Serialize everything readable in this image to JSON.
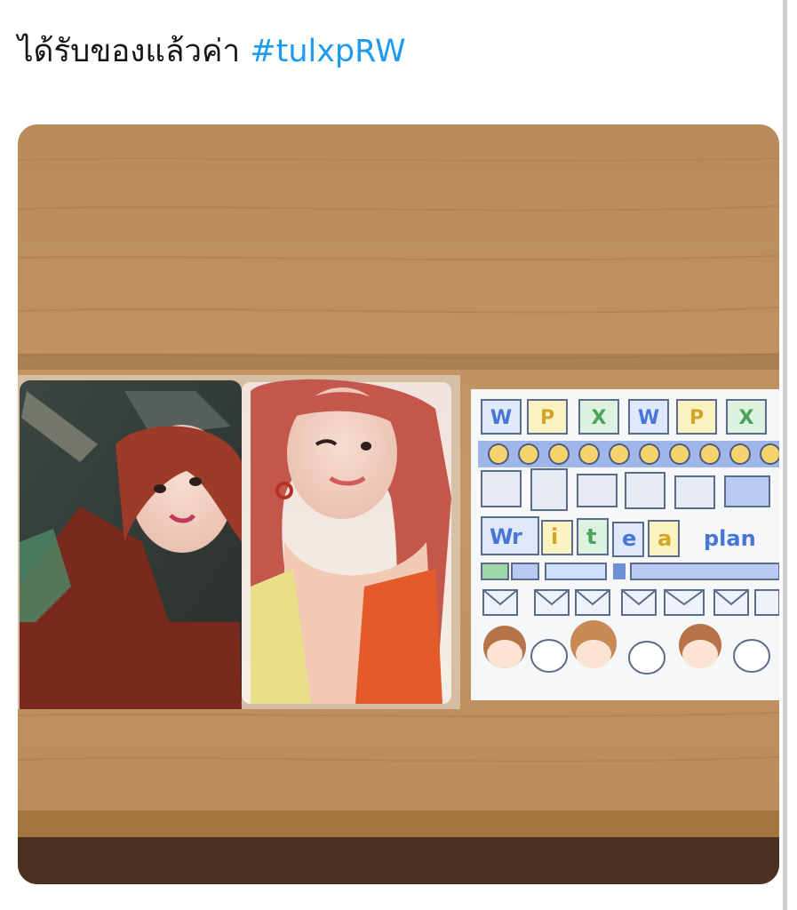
{
  "tweet": {
    "text": "ได้รับของแล้วค่า",
    "hashtag": "#tulxpRW"
  },
  "photo": {
    "sticker_sheet": {
      "tiles_row1": [
        "W",
        "P",
        "X",
        "W",
        "P",
        "X"
      ],
      "title_letters": [
        "W",
        "r",
        "i",
        "t",
        "e",
        "a",
        "p",
        "l",
        "a",
        "n"
      ]
    }
  },
  "colors": {
    "text": "#14171a",
    "link": "#1d9bf0"
  }
}
